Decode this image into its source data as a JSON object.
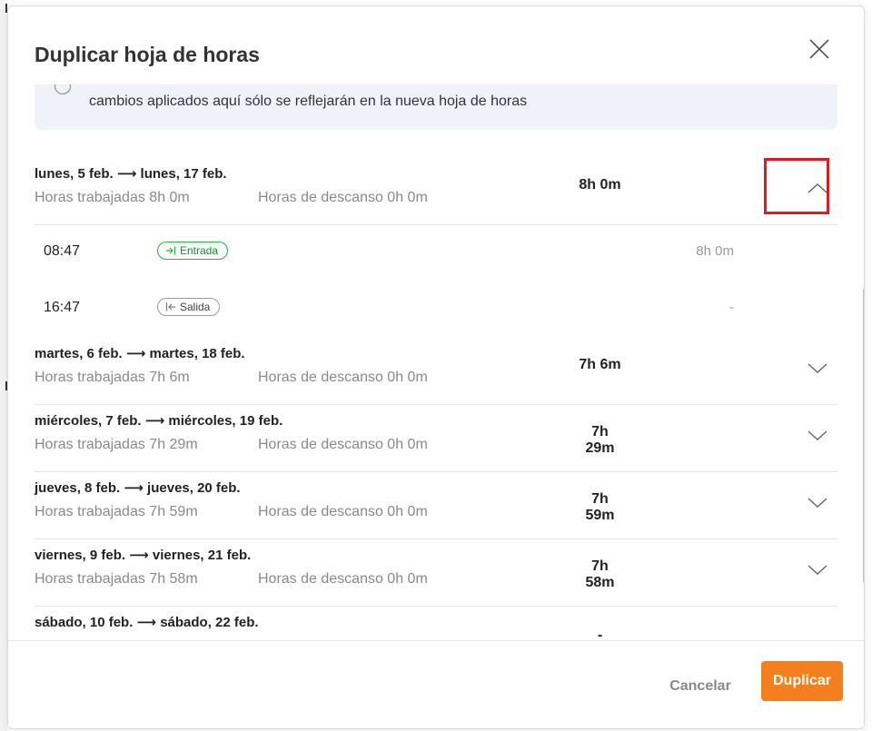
{
  "modal": {
    "title": "Duplicar hoja de horas",
    "info_text": "cambios aplicados aquí sólo se reflejarán en la nueva hoja de horas"
  },
  "days": [
    {
      "date": "lunes, 5 feb. ⟶ lunes, 17 feb.",
      "worked": "Horas trabajadas 8h 0m",
      "break": "Horas de descanso 0h 0m",
      "total": "8h 0m",
      "expanded": true,
      "entries": [
        {
          "time": "08:47",
          "badge": "Entrada",
          "badge_icon": "arrow-in-icon",
          "duration": "8h 0m"
        },
        {
          "time": "16:47",
          "badge": "Salida",
          "badge_icon": "arrow-out-icon",
          "duration": "-"
        }
      ]
    },
    {
      "date": "martes, 6 feb. ⟶ martes, 18 feb.",
      "worked": "Horas trabajadas 7h 6m",
      "break": "Horas de descanso 0h 0m",
      "total": "7h 6m",
      "expanded": false
    },
    {
      "date": "miércoles, 7 feb. ⟶ miércoles, 19 feb.",
      "worked": "Horas trabajadas 7h 29m",
      "break": "Horas de descanso 0h 0m",
      "total": "7h 29m",
      "expanded": false
    },
    {
      "date": "jueves, 8 feb. ⟶ jueves, 20 feb.",
      "worked": "Horas trabajadas 7h 59m",
      "break": "Horas de descanso 0h 0m",
      "total": "7h 59m",
      "expanded": false
    },
    {
      "date": "viernes, 9 feb. ⟶ viernes, 21 feb.",
      "worked": "Horas trabajadas 7h 58m",
      "break": "Horas de descanso 0h 0m",
      "total": "7h 58m",
      "expanded": false
    },
    {
      "date": "sábado, 10 feb. ⟶ sábado, 22 feb.",
      "total": "-",
      "expanded": false
    }
  ],
  "footer": {
    "cancel_label": "Cancelar",
    "duplicate_label": "Duplicar"
  },
  "colors": {
    "accent": "#f37f1f",
    "highlight": "#e0181f",
    "entry_green": "#31b04a"
  },
  "icons": {
    "close": "close-icon",
    "collapse": "chevron-up-icon",
    "expand": "chevron-down-icon",
    "info": "info-icon"
  }
}
